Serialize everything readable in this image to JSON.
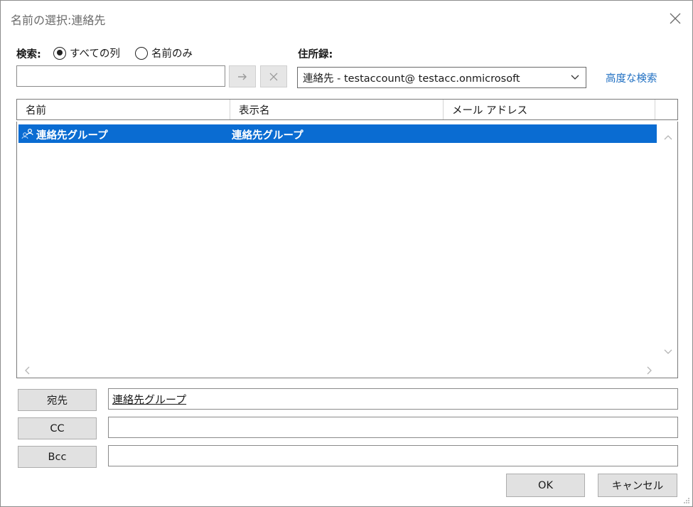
{
  "window": {
    "title": "名前の選択:連絡先"
  },
  "search": {
    "label": "検索:",
    "option_all": "すべての列",
    "option_name": "名前のみ",
    "selected_option": "すべての列",
    "value": "",
    "go_icon": "arrow-right-icon",
    "clear_icon": "close-icon"
  },
  "address_book": {
    "label": "住所録:",
    "selected": "連絡先 - testaccount@ testacc.onmicrosoft",
    "advanced_link": "高度な検索"
  },
  "list": {
    "columns": [
      "名前",
      "表示名",
      "メール アドレス"
    ],
    "rows": [
      {
        "icon": "contact-group-icon",
        "name": "連絡先グループ",
        "display_name": "連絡先グループ",
        "email": "",
        "selected": true
      }
    ]
  },
  "recipients": {
    "to_label": "宛先",
    "to_value": "連絡先グループ",
    "cc_label": "CC",
    "cc_value": "",
    "bcc_label": "Bcc",
    "bcc_value": ""
  },
  "buttons": {
    "ok": "OK",
    "cancel": "キャンセル"
  },
  "colors": {
    "selection": "#0a6cd2",
    "link": "#1f6fc2"
  }
}
